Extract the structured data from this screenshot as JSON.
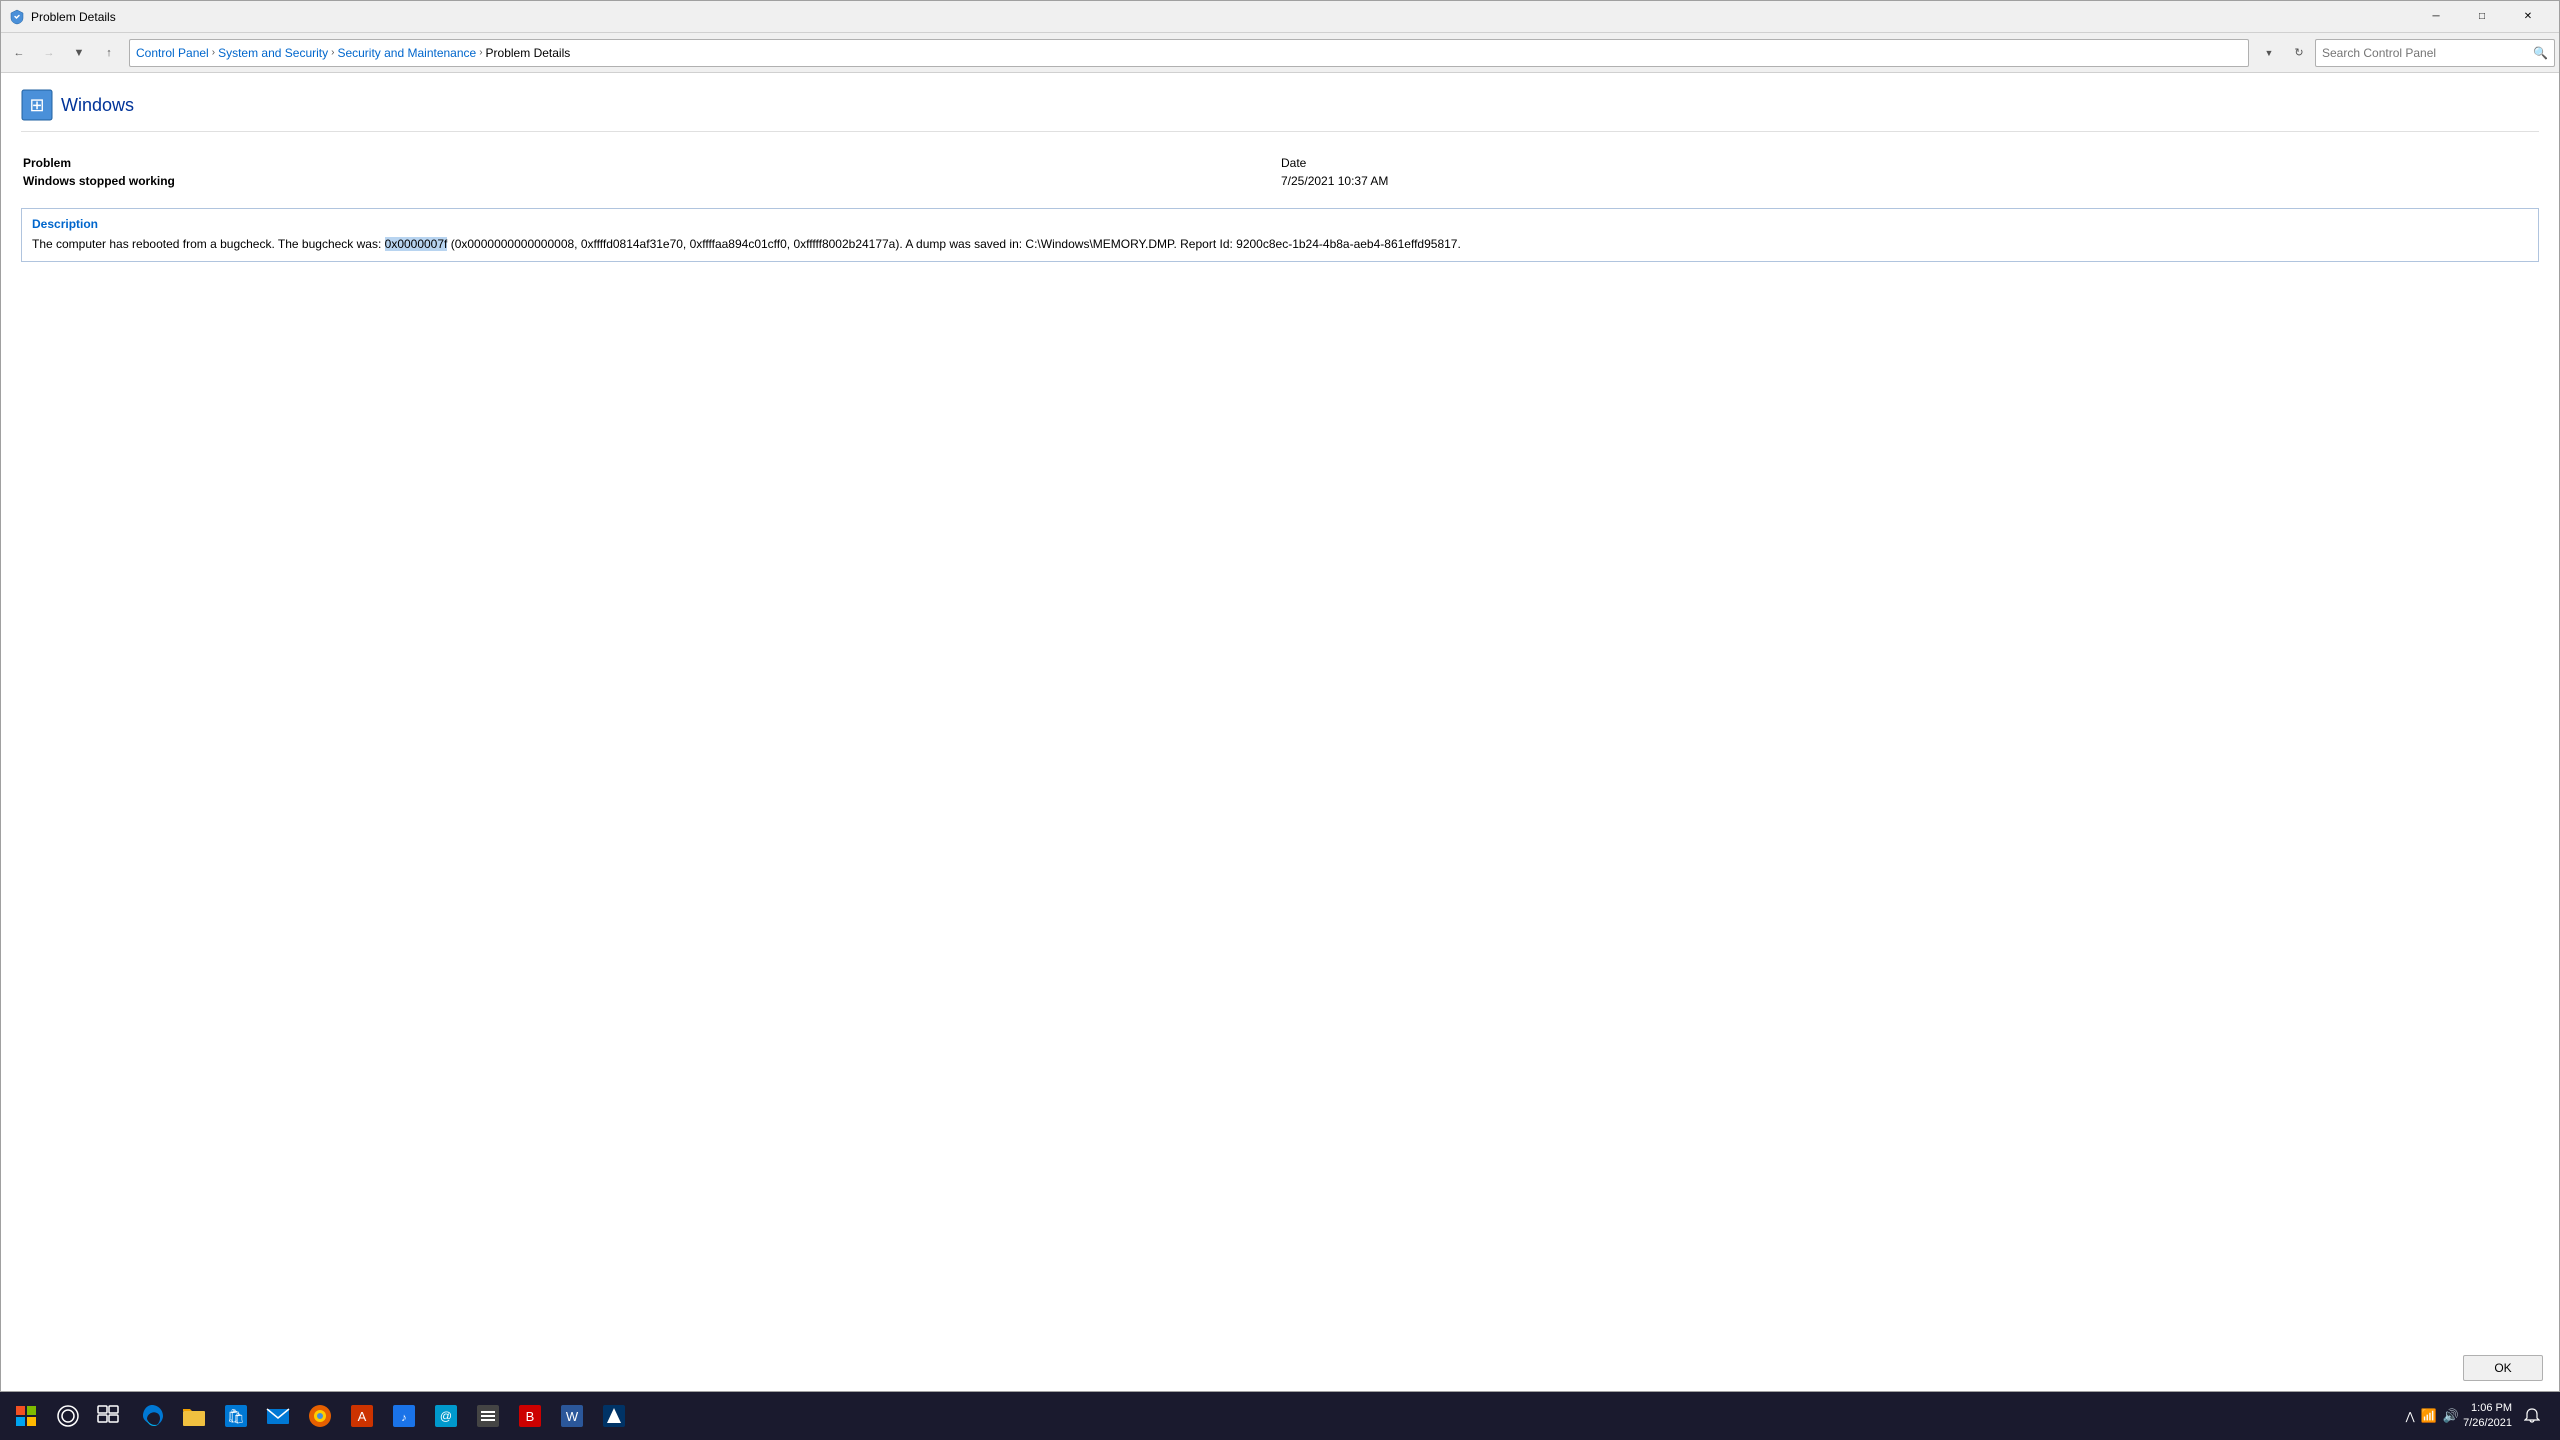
{
  "titleBar": {
    "title": "Problem Details",
    "minimizeLabel": "─",
    "maximizeLabel": "□",
    "closeLabel": "✕"
  },
  "navBar": {
    "backTooltip": "Back",
    "forwardTooltip": "Forward",
    "upTooltip": "Up",
    "breadcrumbs": [
      {
        "label": "Control Panel",
        "current": false
      },
      {
        "label": "System and Security",
        "current": false
      },
      {
        "label": "Security and Maintenance",
        "current": false
      },
      {
        "label": "Problem Details",
        "current": true
      }
    ],
    "searchPlaceholder": "Search Control Panel"
  },
  "appHeader": {
    "title": "Windows"
  },
  "problemInfo": {
    "problemLabel": "Problem",
    "problemValue": "Windows stopped working",
    "dateLabel": "Date",
    "dateValue": "7/25/2021 10:37 AM"
  },
  "description": {
    "title": "Description",
    "textBefore": "The computer has rebooted from a bugcheck.  The bugcheck was: ",
    "highlight": "0x0000007f",
    "textAfter": " (0x0000000000000008, 0xffffd0814af31e70, 0xffffaa894c01cff0, 0xfffff8002b24177a). A dump was saved in: C:\\Windows\\MEMORY.DMP. Report Id: 9200c8ec-1b24-4b8a-aeb4-861effd95817."
  },
  "okButton": {
    "label": "OK"
  },
  "taskbar": {
    "time": "1:06 PM",
    "date": "7/26/2021",
    "icons": [
      {
        "name": "start",
        "symbol": "⊞"
      },
      {
        "name": "search",
        "symbol": "○"
      },
      {
        "name": "task-view",
        "symbol": "❑"
      },
      {
        "name": "edge",
        "color": "#0078d4"
      },
      {
        "name": "file-explorer",
        "color": "#f0c040"
      },
      {
        "name": "store",
        "color": "#0078d4"
      },
      {
        "name": "mail",
        "color": "#0078d4"
      },
      {
        "name": "firefox",
        "color": "#e66000"
      },
      {
        "name": "app1",
        "color": "#cc3300"
      },
      {
        "name": "amazon-music",
        "color": "#1a73e8"
      },
      {
        "name": "app2",
        "color": "#0099cc"
      },
      {
        "name": "app3",
        "color": "#555555"
      },
      {
        "name": "bitdefender",
        "color": "#cc0000"
      },
      {
        "name": "word",
        "color": "#2b579a"
      },
      {
        "name": "app4",
        "color": "#003366"
      }
    ]
  }
}
